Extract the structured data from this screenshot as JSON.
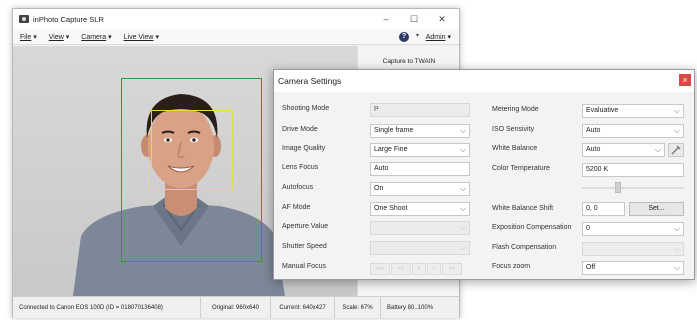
{
  "window": {
    "title": "inPhoto Capture SLR",
    "minimize_glyph": "–",
    "maximize_glyph": "☐",
    "close_glyph": "✕"
  },
  "menu": {
    "file": "File",
    "view": "View",
    "camera": "Camera",
    "live_view": "Live View",
    "admin": "Admin",
    "caret": "▾",
    "help_glyph": "?"
  },
  "right_panel": {
    "capture_button": "Capture to TWAIN"
  },
  "status": {
    "connection": "Connected to Canon EOS 100D (ID = 018070136408)",
    "original": "Original: 960x640",
    "current": "Current: 640x427",
    "scale": "Scale: 67%",
    "battery": "Battery 80..100%"
  },
  "dialog": {
    "title": "Camera Settings",
    "close_glyph": "×",
    "left": [
      {
        "label": "Shooting Mode",
        "value": "P"
      },
      {
        "label": "Drive Mode",
        "value": "Single frame"
      },
      {
        "label": "Image Quality",
        "value": "Large Fine"
      },
      {
        "label": "Lens Focus",
        "value": "Auto"
      },
      {
        "label": "Autofocus",
        "value": "On"
      },
      {
        "label": "AF Mode",
        "value": "One Shoot"
      },
      {
        "label": "Aperture Value",
        "value": ""
      },
      {
        "label": "Shutter Speed",
        "value": ""
      },
      {
        "label": "Manual Focus",
        "value": ""
      }
    ],
    "focus_buttons": [
      "<<<",
      "<<",
      "<",
      ">",
      ">>",
      ">>>"
    ],
    "right": [
      {
        "label": "Metering Mode",
        "value": "Evaluative"
      },
      {
        "label": "ISO Sensivity",
        "value": "Auto"
      },
      {
        "label": "White Balance",
        "value": "Auto"
      },
      {
        "label": "Color Temperature",
        "value": "5200 K"
      },
      {
        "label": "White Balance Shift",
        "value": "0, 0"
      },
      {
        "label": "Exposition Compensation",
        "value": "0"
      },
      {
        "label": "Flash Compensation",
        "value": ""
      },
      {
        "label": "Focus zoom",
        "value": "Off"
      }
    ],
    "set_button": "Set...",
    "color_temp_slider_position": 0.34
  },
  "colors": {
    "face_frame": "#2f9a2f",
    "face_detect_box": "#e6dc3a",
    "close_red": "#e04646"
  }
}
